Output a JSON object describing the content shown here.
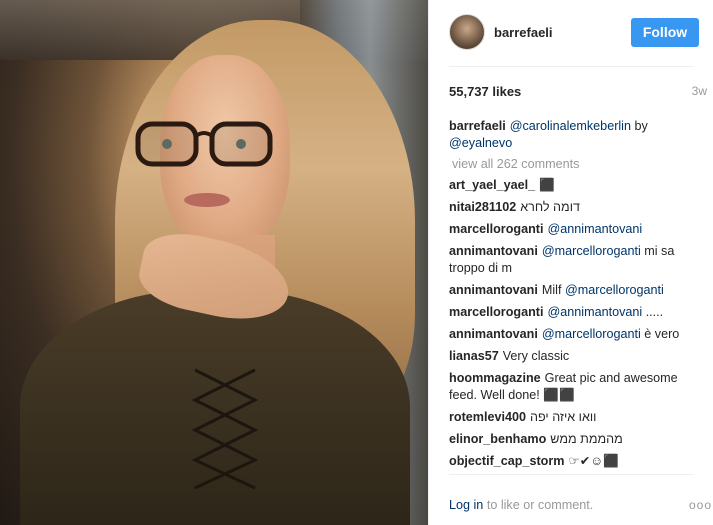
{
  "post": {
    "username": "barrefaeli",
    "follow_label": "Follow",
    "likes": "55,737 likes",
    "time": "3w",
    "caption": {
      "user": "barrefaeli",
      "mention1": "@carolinalemkeberlin",
      "by": "by",
      "mention2": "@eyalnevo"
    },
    "view_all": "view all 262 comments",
    "comments": [
      {
        "user": "art_yael_yael_",
        "text": "⬛",
        "mention": "",
        "tail": ""
      },
      {
        "user": "nitai281102",
        "text": "דומה לחרא",
        "mention": "",
        "tail": ""
      },
      {
        "user": "marcelloroganti",
        "text": "",
        "mention": "@annimantovani",
        "tail": ""
      },
      {
        "user": "annimantovani",
        "text": "",
        "mention": "@marcelloroganti",
        "tail": "mi sa troppo di m"
      },
      {
        "user": "annimantovani",
        "text": "Milf",
        "mention": "@marcelloroganti",
        "tail": ""
      },
      {
        "user": "marcelloroganti",
        "text": "",
        "mention": "@annimantovani",
        "tail": "....."
      },
      {
        "user": "annimantovani",
        "text": "",
        "mention": "@marcelloroganti",
        "tail": "è vero"
      },
      {
        "user": "lianas57",
        "text": "Very classic",
        "mention": "",
        "tail": ""
      },
      {
        "user": "hoommagazine",
        "text": "Great pic and awesome feed. Well done! ⬛⬛",
        "mention": "",
        "tail": ""
      },
      {
        "user": "rotemlevi400",
        "text": "וואו איזה יפה",
        "mention": "",
        "tail": ""
      },
      {
        "user": "elinor_benhamo",
        "text": "מהממת ממש",
        "mention": "",
        "tail": ""
      },
      {
        "user": "objectif_cap_storm",
        "text": "☞✔☺⬛",
        "mention": "",
        "tail": ""
      }
    ],
    "login_link": "Log in",
    "login_rest": "to like or comment.",
    "more": "ooo"
  },
  "colors": {
    "accent": "#3897f0",
    "mention": "#003569",
    "muted": "#999999"
  }
}
